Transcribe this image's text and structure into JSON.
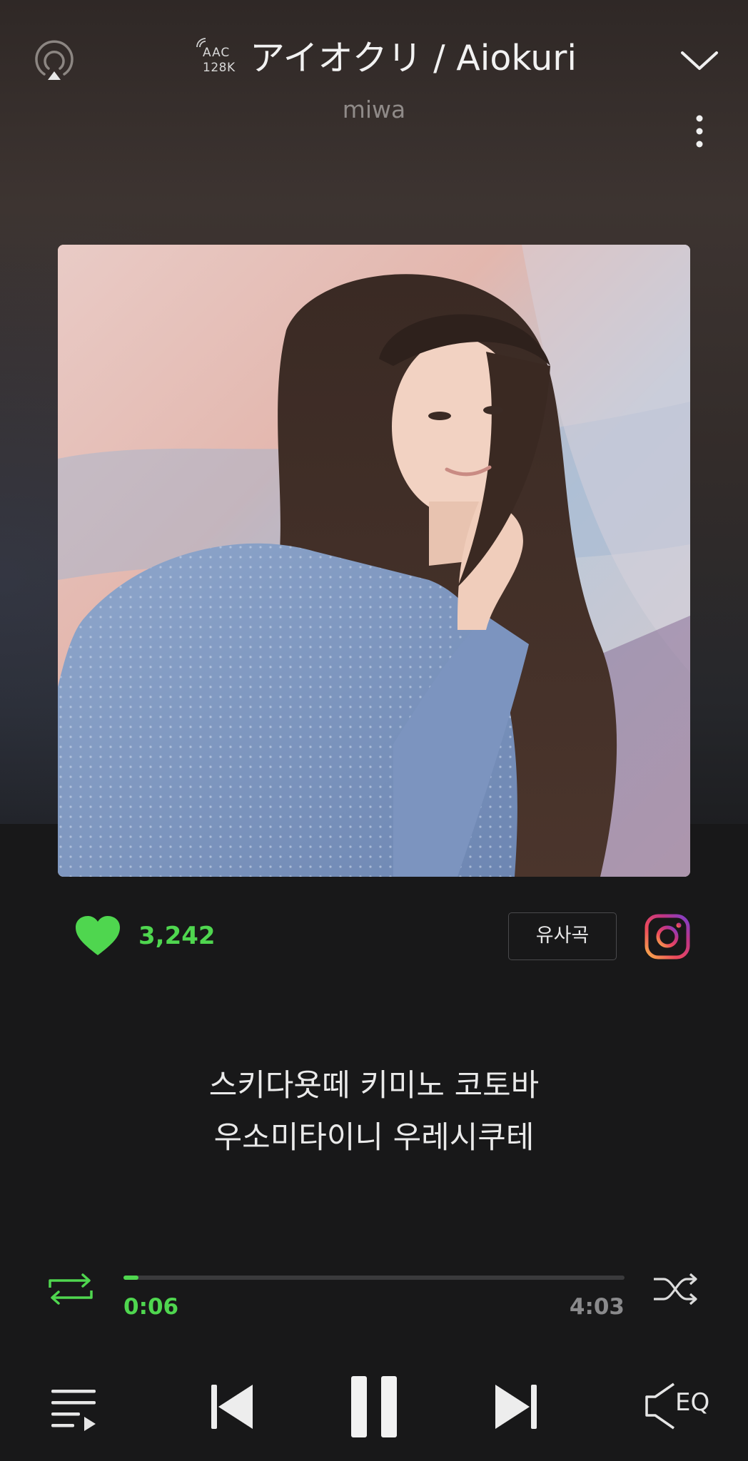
{
  "header": {
    "quality_codec": "AAC",
    "quality_bitrate": "128K",
    "title": "アイオクリ / Aiokuri",
    "artist": "miwa",
    "icons": [
      "airplay-icon",
      "chevron-down-icon",
      "more-vertical-icon"
    ]
  },
  "stats": {
    "like_count": "3,242",
    "similar_label": "유사곡",
    "icons": [
      "heart-icon",
      "instagram-icon"
    ]
  },
  "lyrics": {
    "line1": "스키다욧떼 키미노 코토바",
    "line2": "우소미타이니 우레시쿠테"
  },
  "progress": {
    "elapsed": "0:06",
    "total": "4:03",
    "fraction": 0.025
  },
  "controls": {
    "icons": [
      "repeat-icon",
      "shuffle-icon",
      "playlist-icon",
      "previous-icon",
      "pause-icon",
      "next-icon",
      "equalizer-icon"
    ],
    "eq_label": "EQ"
  },
  "colors": {
    "accent": "#4fd64f",
    "background": "#181819"
  }
}
